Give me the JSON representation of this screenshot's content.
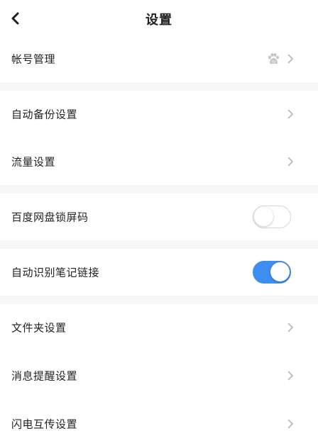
{
  "header": {
    "title": "设置",
    "back_icon": "chevron-left-icon"
  },
  "settings": {
    "account": {
      "label": "帐号管理",
      "icon": "baidu-paw-icon"
    },
    "auto_backup": {
      "label": "自动备份设置"
    },
    "data_usage": {
      "label": "流量设置"
    },
    "lock_screen_code": {
      "label": "百度网盘锁屏码",
      "toggle_on": false
    },
    "auto_detect_note_links": {
      "label": "自动识别笔记链接",
      "toggle_on": true
    },
    "folder": {
      "label": "文件夹设置"
    },
    "notifications": {
      "label": "消息提醒设置"
    },
    "flash_transfer": {
      "label": "闪电互传设置"
    }
  },
  "colors": {
    "accent": "#3d8ef0",
    "section_gap": "#f7f7f8",
    "chevron": "#b8b8bc"
  }
}
